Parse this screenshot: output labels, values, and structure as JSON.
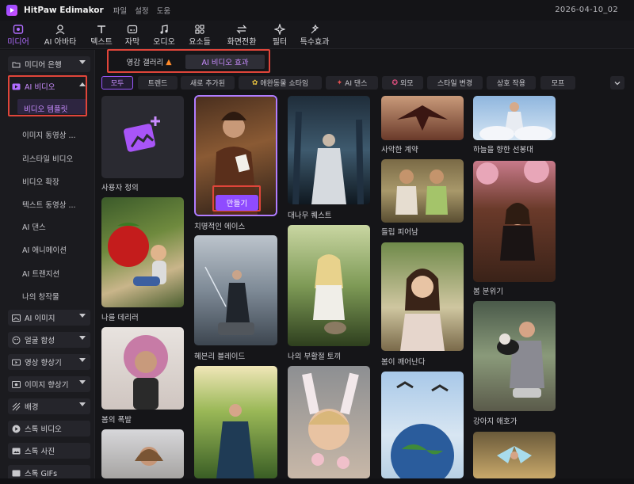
{
  "app": {
    "title": "HitPaw Edimakor",
    "menu": [
      "파일",
      "설정",
      "도움"
    ],
    "date": "2026-04-10_02"
  },
  "toolbar": [
    {
      "label": "미디어",
      "icon": "media-icon",
      "active": true
    },
    {
      "label": "AI 아바타",
      "icon": "avatar-icon",
      "active": false
    },
    {
      "label": "텍스트",
      "icon": "text-icon",
      "active": false
    },
    {
      "label": "자막",
      "icon": "subtitle-icon",
      "active": false
    },
    {
      "label": "오디오",
      "icon": "audio-icon",
      "active": false
    },
    {
      "label": "요소들",
      "icon": "elements-icon",
      "active": false
    },
    {
      "label": "화면전환",
      "icon": "transition-icon",
      "active": false
    },
    {
      "label": "필터",
      "icon": "filter-icon",
      "active": false
    },
    {
      "label": "특수효과",
      "icon": "effects-icon",
      "active": false
    }
  ],
  "sidebar": {
    "media_library": "미디어 은행",
    "ai_video": "AI 비디오",
    "ai_video_sub": [
      "비디오 템플릿",
      "이미지 동영상 ...",
      "리스타일 비디오",
      "비디오 확장",
      "텍스트 동영상 ...",
      "AI 댄스",
      "AI 애니메이션",
      "AI 트랜지션",
      "나의 창작물"
    ],
    "sections": [
      "AI 이미지",
      "얼굴 합성",
      "영상 향상기",
      "이미지 향상기",
      "배경",
      "스톡 비디오",
      "스톡 사진",
      "스톡 GIFs"
    ]
  },
  "gallery_tabs": [
    "영감 갤러리",
    "AI 비디오 효과"
  ],
  "chips": [
    "모두",
    "트렌드",
    "새로 추가된",
    "애완동물 쇼타임",
    "AI 댄스",
    "외모",
    "스타일 변경",
    "상호 작용",
    "모프"
  ],
  "cards": {
    "custom": "사용자 정의",
    "c1": "나를 데리러",
    "c2": "봄의 폭발",
    "c3": "치명적인 에이스",
    "c4": "혜븐리 블레이드",
    "c5": "대나무 퀘스트",
    "c6": "나의 부활절 토끼",
    "c7": "사악한 계약",
    "c8": "들립 피어남",
    "c9": "봄이 깨어난다",
    "c10": "하늘을 향한 선봉대",
    "c11": "봄 분위기",
    "c12": "강아지 애호가",
    "create_label": "만들기"
  },
  "colors": {
    "accent": "#9b59ff",
    "highlight_box": "#e0453a",
    "background": "#151518"
  }
}
